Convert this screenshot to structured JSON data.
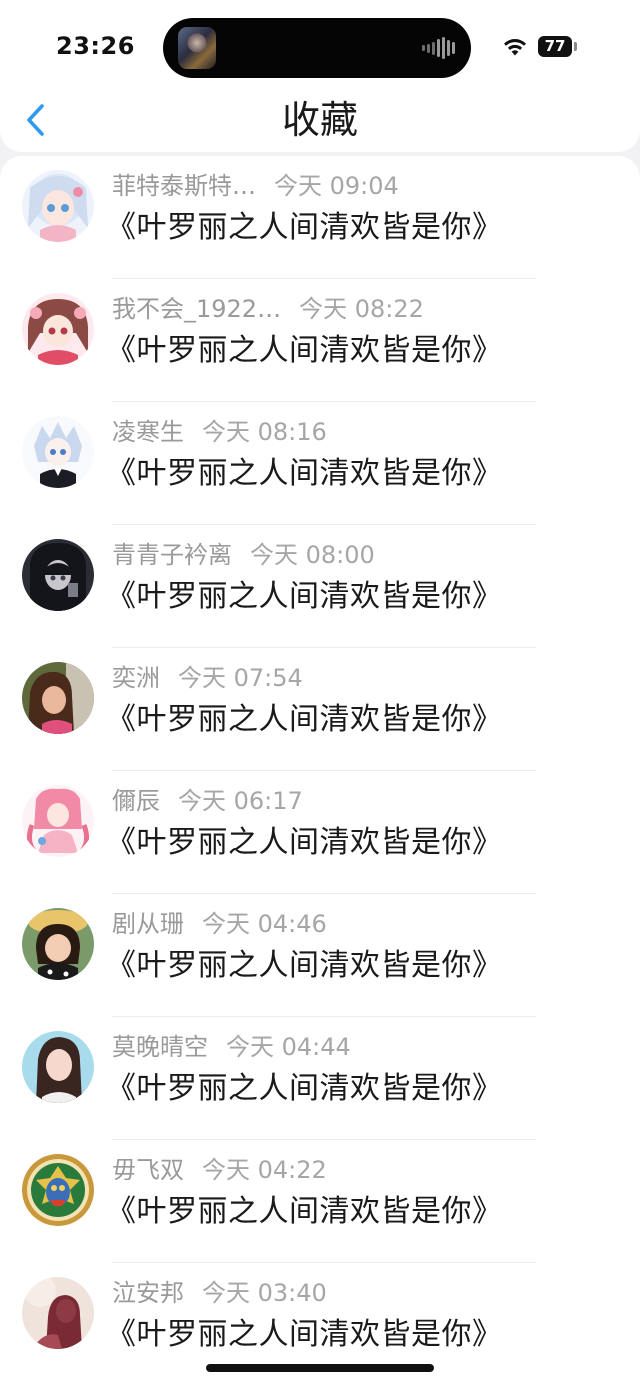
{
  "status_bar": {
    "time": "23:26",
    "battery": "77"
  },
  "nav": {
    "title": "收藏"
  },
  "items": [
    {
      "nickname": "菲特泰斯特…",
      "time": "今天 09:04",
      "title": "《叶罗丽之人间清欢皆是你》"
    },
    {
      "nickname": "我不会_1922…",
      "time": "今天 08:22",
      "title": "《叶罗丽之人间清欢皆是你》"
    },
    {
      "nickname": "凌寒生",
      "time": "今天 08:16",
      "title": "《叶罗丽之人间清欢皆是你》"
    },
    {
      "nickname": "青青子衿离",
      "time": "今天 08:00",
      "title": "《叶罗丽之人间清欢皆是你》"
    },
    {
      "nickname": "奕洲",
      "time": "今天 07:54",
      "title": "《叶罗丽之人间清欢皆是你》"
    },
    {
      "nickname": "儞辰",
      "time": "今天 06:17",
      "title": "《叶罗丽之人间清欢皆是你》"
    },
    {
      "nickname": "剧从珊",
      "time": "今天 04:46",
      "title": "《叶罗丽之人间清欢皆是你》"
    },
    {
      "nickname": "莫晚晴空",
      "time": "今天 04:44",
      "title": "《叶罗丽之人间清欢皆是你》"
    },
    {
      "nickname": "毋飞双",
      "time": "今天 04:22",
      "title": "《叶罗丽之人间清欢皆是你》"
    },
    {
      "nickname": "泣安邦",
      "time": "今天 03:40",
      "title": "《叶罗丽之人间清欢皆是你》"
    }
  ],
  "colors": {
    "accent": "#2f9bf0",
    "text_primary": "#1a1a1a",
    "text_secondary": "#9a9a9a"
  }
}
